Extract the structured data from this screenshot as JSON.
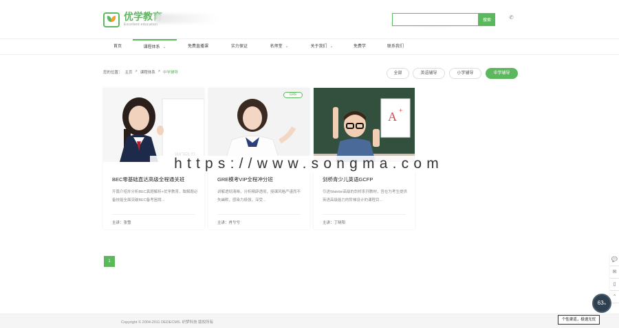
{
  "header": {
    "logo_title": "优学教育",
    "logo_sub": "Excellent education",
    "search": {
      "value": "",
      "placeholder": "",
      "button": "搜索"
    },
    "phone_icon": "phone-icon"
  },
  "nav": {
    "items": [
      {
        "label": "首页"
      },
      {
        "label": "课程体系"
      },
      {
        "label": "免费直播课"
      },
      {
        "label": "实力保证"
      },
      {
        "label": "名师堂"
      },
      {
        "label": "关于我们"
      },
      {
        "label": "免费学"
      },
      {
        "label": "联系我们"
      }
    ]
  },
  "breadcrumb": {
    "prefix": "您的位置：",
    "items": [
      "主页",
      "课程体系",
      "中学辅导"
    ],
    "sep": ">"
  },
  "filters": [
    {
      "label": "全部"
    },
    {
      "label": "英语辅导"
    },
    {
      "label": "小学辅导"
    },
    {
      "label": "中学辅导"
    }
  ],
  "cards": [
    {
      "title": "BEC零基础直达高级全程通关班",
      "desc": "开篇介绍并分析BEC真题解析+优学教育，致解题必备技能全面突破BEC备考困境...",
      "teacher": "主讲：张雪",
      "tag": ""
    },
    {
      "title": "GRE模考VIP全程冲分班",
      "desc": "讲解透彻清晰，分析精辟透彻，授课风格严谨而不失幽默，感染力极强，深受...",
      "teacher": "主讲：肖兮兮",
      "tag": "GRE"
    },
    {
      "title": "剑桥青少儿英语GCFP",
      "desc": "引进Walebe高级的剑桥系列教材，旨在为考生提供英语高级能力的阶梯设计的课程目...",
      "teacher": "主讲：丁晓阳",
      "tag": ""
    }
  ],
  "pagination": {
    "current": "1"
  },
  "footer": {
    "copyright": "Copyright © 2004-2011 DEDECMS. 织梦科技 版权所有",
    "status": "个性渠道，极速无忧"
  },
  "sidebar": {
    "icons": [
      "chat-icon",
      "share-icon",
      "mobile-icon",
      "up-icon"
    ]
  },
  "gauge": {
    "value": "63",
    "unit": "%"
  },
  "watermark": "https://www.songma.com",
  "colors": {
    "accent": "#5cb85c"
  }
}
